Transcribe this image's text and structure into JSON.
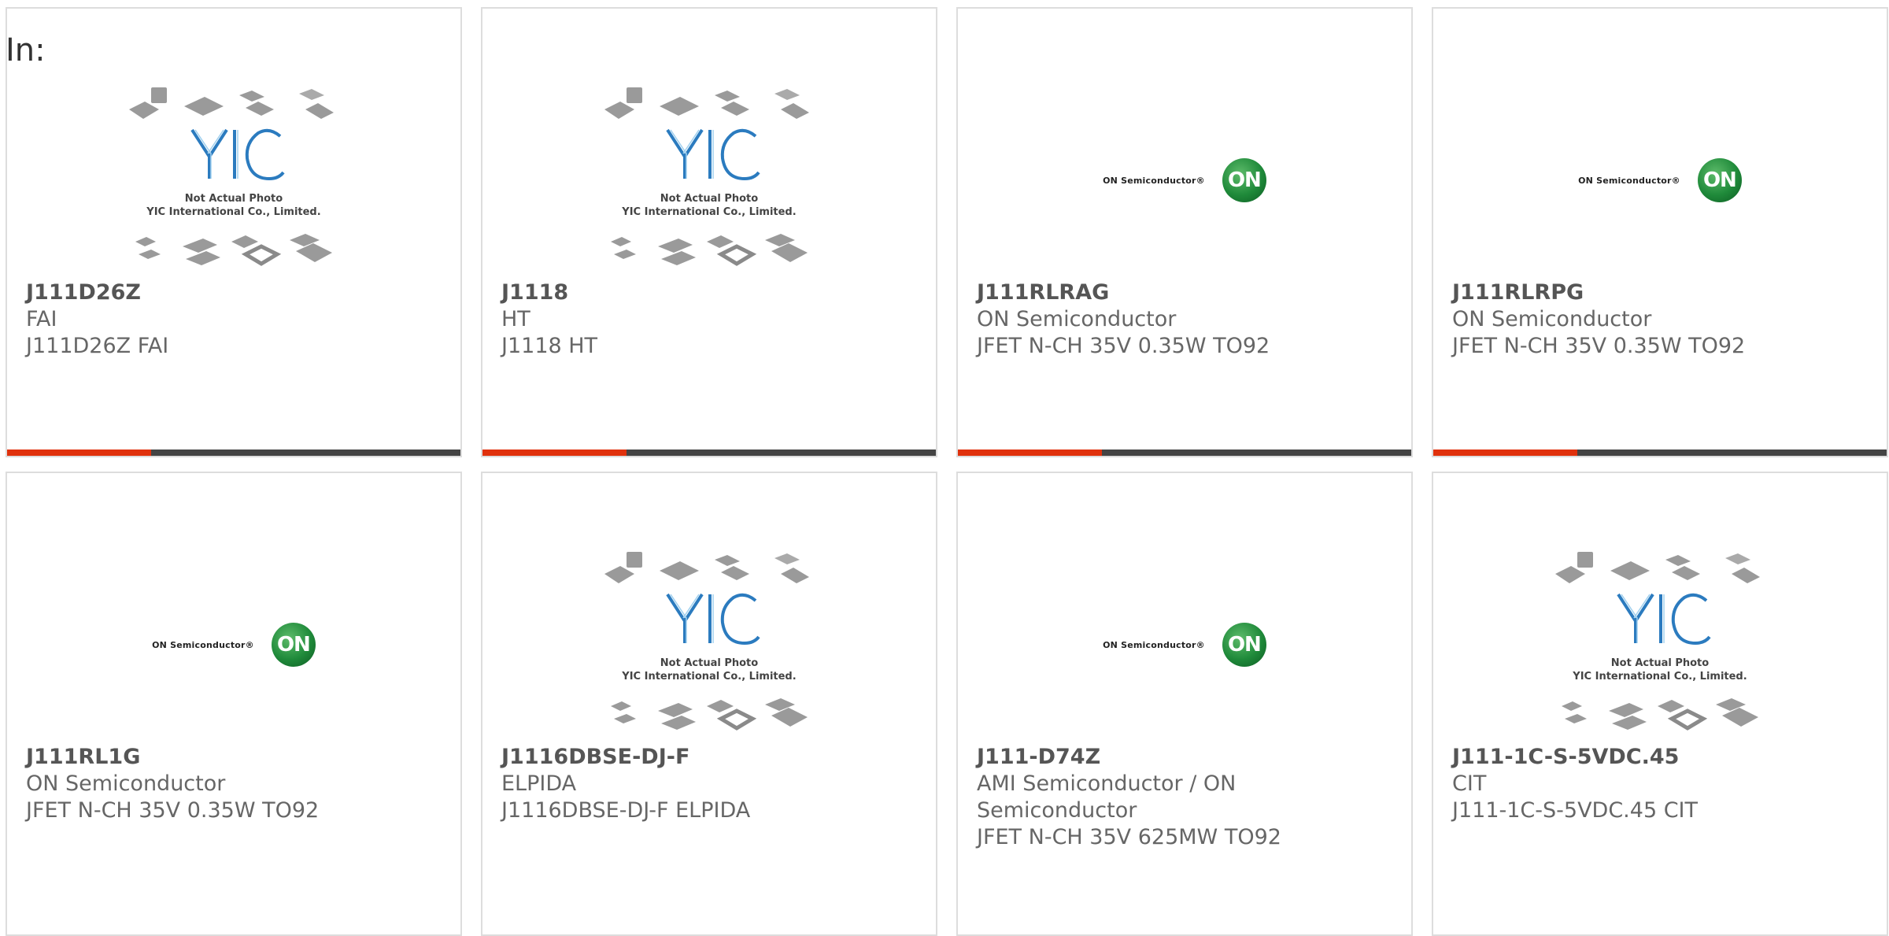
{
  "header": {
    "label": "In:"
  },
  "placeholder": {
    "line1": "Not Actual Photo",
    "line2": "YIC International Co., Limited.",
    "logo_text": "YIC"
  },
  "on_logo": {
    "word": "ON Semiconductor®",
    "badge": "ON"
  },
  "colors": {
    "accent": "#e0310c",
    "bar": "#444444",
    "on_green": "#1f8a3a",
    "yic_blue": "#2b7bbf"
  },
  "products": [
    {
      "part": "J111D26Z",
      "maker": "FAI",
      "desc": "J111D26Z FAI",
      "image": "yic-placeholder",
      "bar": true
    },
    {
      "part": "J1118",
      "maker": "HT",
      "desc": "J1118 HT",
      "image": "yic-placeholder",
      "bar": true
    },
    {
      "part": "J111RLRAG",
      "maker": "ON Semiconductor",
      "desc": "JFET N-CH 35V 0.35W TO92",
      "image": "on-logo",
      "bar": true
    },
    {
      "part": "J111RLRPG",
      "maker": "ON Semiconductor",
      "desc": "JFET N-CH 35V 0.35W TO92",
      "image": "on-logo",
      "bar": true
    },
    {
      "part": "J111RL1G",
      "maker": "ON Semiconductor",
      "desc": "JFET N-CH 35V 0.35W TO92",
      "image": "on-logo",
      "bar": false
    },
    {
      "part": "J1116DBSE-DJ-F",
      "maker": "ELPIDA",
      "desc": "J1116DBSE-DJ-F ELPIDA",
      "image": "yic-placeholder",
      "bar": false
    },
    {
      "part": "J111-D74Z",
      "maker": "AMI Semiconductor / ON Semiconductor",
      "desc": "JFET N-CH 35V 625MW TO92",
      "image": "on-logo",
      "bar": false
    },
    {
      "part": "J111-1C-S-5VDC.45",
      "maker": "CIT",
      "desc": "J111-1C-S-5VDC.45 CIT",
      "image": "yic-placeholder",
      "bar": false
    }
  ]
}
